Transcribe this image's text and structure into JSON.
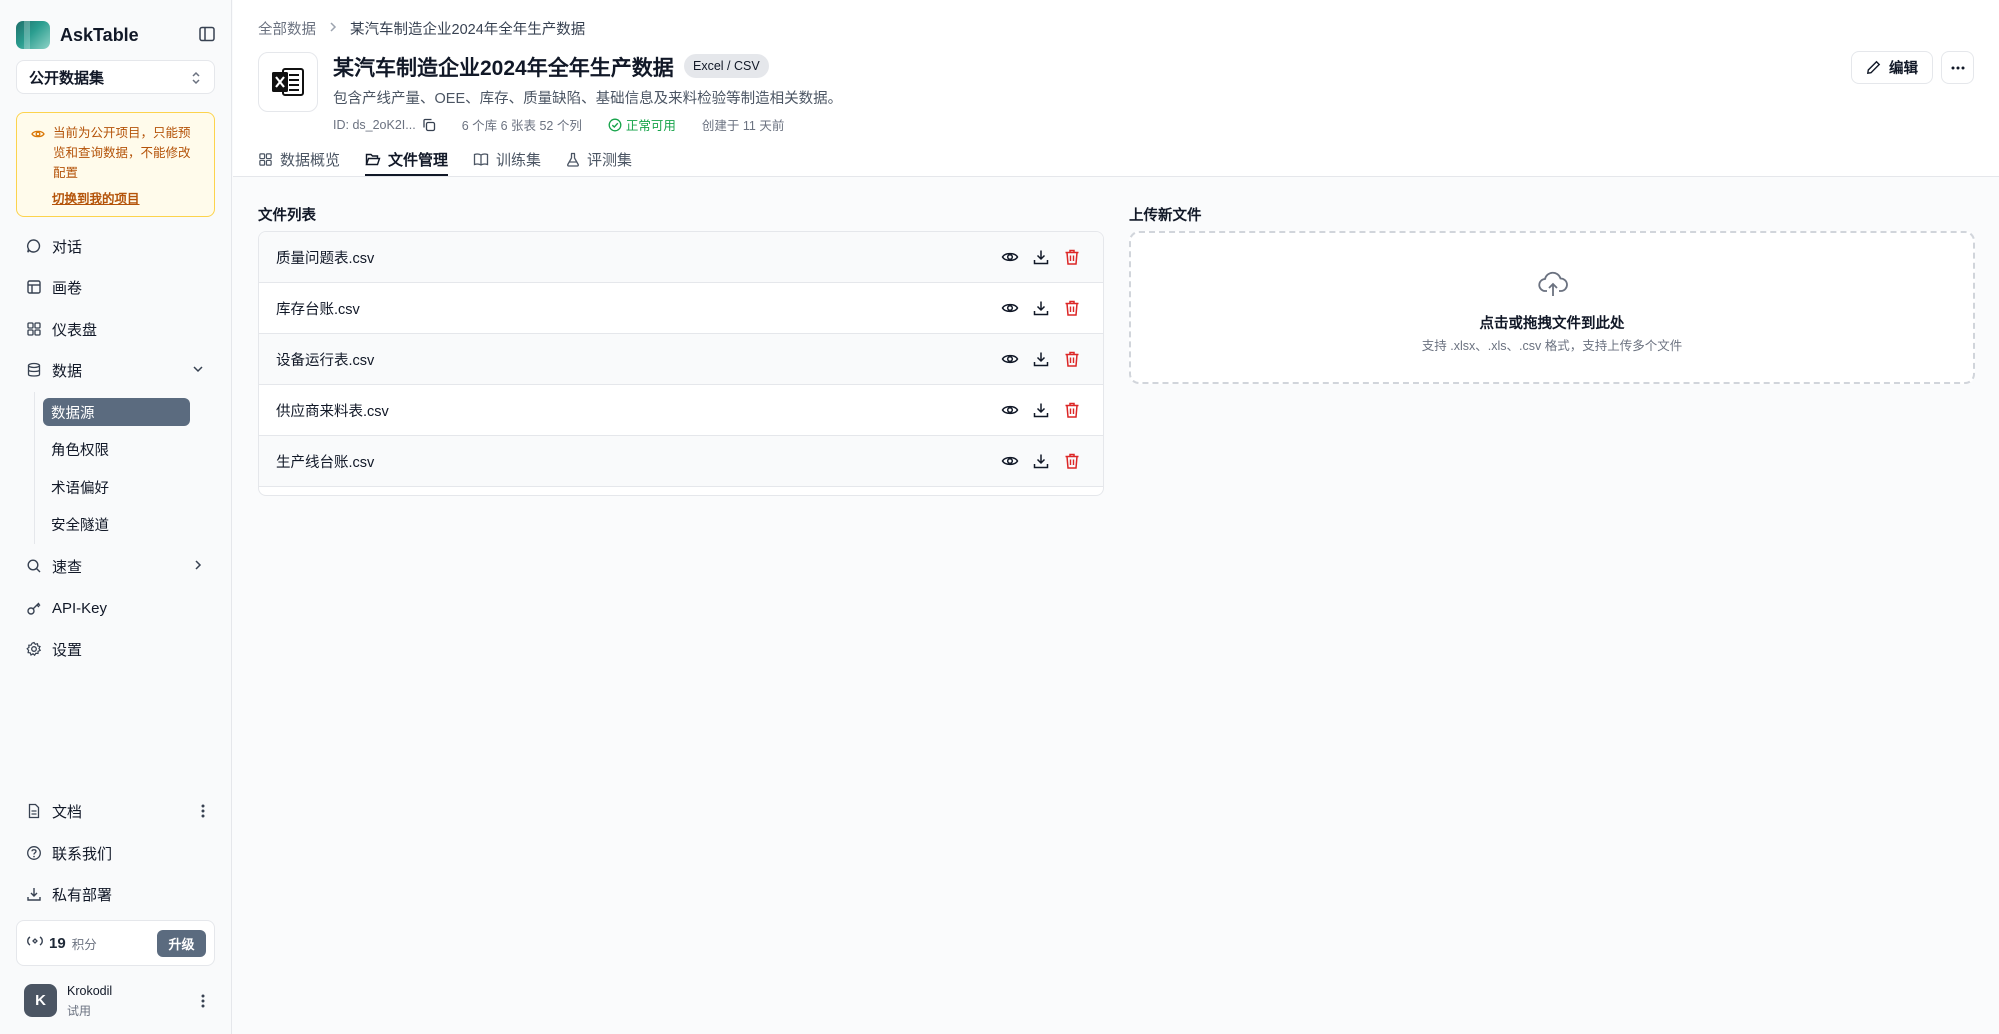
{
  "app": {
    "name": "AskTable"
  },
  "sidebar": {
    "project_select": "公开数据集",
    "notice": {
      "text": "当前为公开项目，只能预览和查询数据，不能修改配置",
      "link": "切换到我的项目"
    },
    "nav": {
      "chat": "对话",
      "canvas": "画卷",
      "dashboard": "仪表盘",
      "data": "数据",
      "quick_search": "速查",
      "api_key": "API-Key",
      "settings": "设置"
    },
    "data_sub": [
      "数据源",
      "角色权限",
      "术语偏好",
      "安全隧道"
    ],
    "bottom": {
      "docs": "文档",
      "contact": "联系我们",
      "private_deploy": "私有部署"
    },
    "credits": {
      "value": "19",
      "unit": "积分",
      "upgrade": "升级"
    },
    "user": {
      "initial": "K",
      "name": "Krokodil",
      "plan": "试用"
    }
  },
  "header": {
    "breadcrumb": [
      "全部数据",
      "某汽车制造企业2024年全年生产数据"
    ],
    "title": "某汽车制造企业2024年全年生产数据",
    "type_badge": "Excel / CSV",
    "description": "包含产线产量、OEE、库存、质量缺陷、基础信息及来料检验等制造相关数据。",
    "id": "ID: ds_2oK2I...",
    "stats": "6 个库 6 张表 52 个列",
    "status": "正常可用",
    "created": "创建于 11 天前",
    "edit": "编辑",
    "tabs": [
      "数据概览",
      "文件管理",
      "训练集",
      "评测集"
    ]
  },
  "files": {
    "label": "文件列表",
    "items": [
      "质量问题表.csv",
      "库存台账.csv",
      "设备运行表.csv",
      "供应商来料表.csv",
      "生产线台账.csv"
    ]
  },
  "upload": {
    "label": "上传新文件",
    "title": "点击或拖拽文件到此处",
    "hint": "支持 .xlsx、.xls、.csv 格式，支持上传多个文件"
  },
  "colors": {
    "accent": "#5b6b7f",
    "danger": "#dc2626",
    "success": "#16a34a",
    "notice_bg": "#fffbeb",
    "notice_text": "#b45309"
  }
}
